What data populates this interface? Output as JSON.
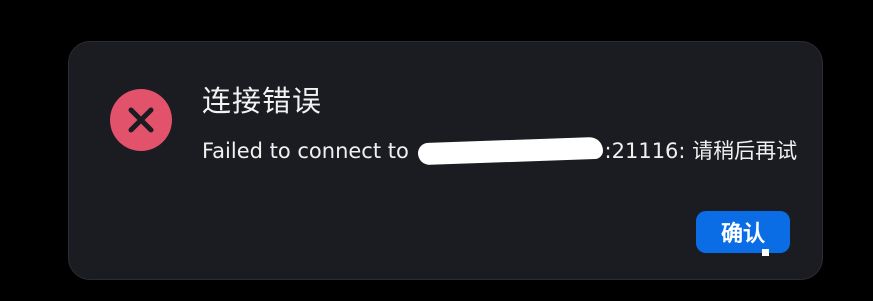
{
  "dialog": {
    "icon": "error-x-icon",
    "title": "连接错误",
    "message_prefix": "Failed to connect to",
    "message_suffix": ":21116: 请稍后再试",
    "confirm_label": "确认"
  },
  "colors": {
    "background": "#000000",
    "dialog_bg": "#1b1c21",
    "error_icon": "#e2526a",
    "primary_button": "#0a6de6"
  }
}
